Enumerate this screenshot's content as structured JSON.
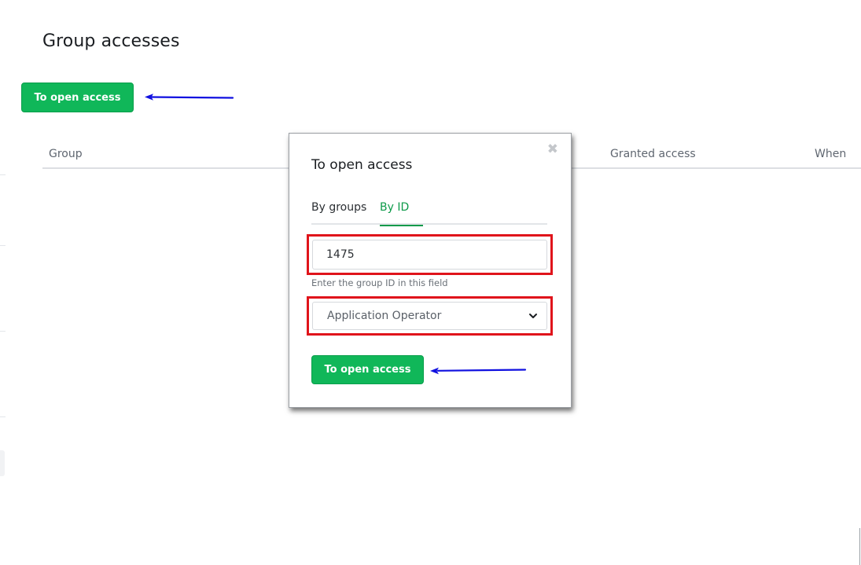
{
  "page": {
    "title": "Group accesses"
  },
  "toolbar": {
    "open_access_label": "To open access"
  },
  "table": {
    "columns": [
      "Group",
      "Granted access",
      "When"
    ]
  },
  "modal": {
    "title": "To open access",
    "close_symbol": "✖",
    "tabs": [
      {
        "label": "By groups",
        "active": false
      },
      {
        "label": "By ID",
        "active": true
      }
    ],
    "id_input": {
      "value": "1475",
      "help": "Enter the group ID in this field"
    },
    "role_select": {
      "value": "Application Operator"
    },
    "submit_label": "To open access"
  },
  "colors": {
    "accent_green": "#10b759",
    "highlight_red": "#e0141b",
    "annotation_blue": "#1010e0"
  }
}
